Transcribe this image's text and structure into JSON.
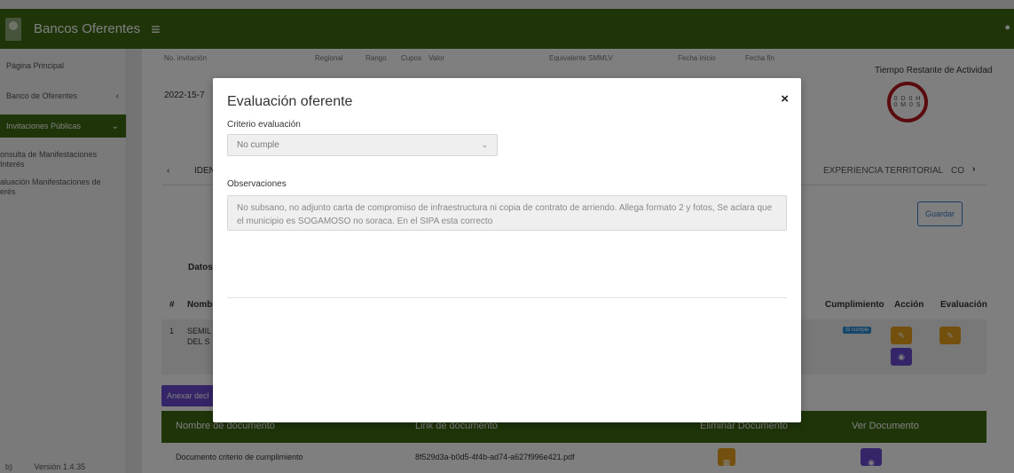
{
  "topbar": {
    "title": "Bancos Oferentes"
  },
  "sidebar": {
    "items": [
      {
        "label": "Página Principal"
      },
      {
        "label": "Banco de Oferentes"
      },
      {
        "label": "Invitaciones Públicas"
      }
    ],
    "subitems": [
      {
        "line1": "onsulta de Manifestaciones",
        "line2": "Interés"
      },
      {
        "line1": "aluación Manifestaciones de",
        "line2": "erés"
      }
    ],
    "footer_left": "b)",
    "version": "Versión 1.4.35"
  },
  "background": {
    "headers": [
      "No. invitación",
      "Regional",
      "Rango",
      "Cupos",
      "Valor",
      "Equivalente SMMLV",
      "Fecha inicio",
      "Fecha fin"
    ],
    "invitation_no": "2022-15-7",
    "timer_title": "Tiempo Restante de Actividad",
    "timer_line1": "0 D 0 H",
    "timer_line2": "0 M 0 S",
    "tab_left": "IDEN",
    "tab_experiencia": "EXPERIENCIA TERRITORIAL",
    "tab_right": "CO",
    "guardar": "Guardar",
    "datos": "Datos",
    "table_headers": {
      "num": "#",
      "nombre": "Nombr",
      "cumplimiento": "Cumplimiento",
      "accion": "Acción",
      "evaluacion": "Evaluación"
    },
    "row": {
      "num": "1",
      "name1": "SEMIL",
      "name2": "DEL S",
      "badge": "Si cumple"
    },
    "anexar": "Anexar decl",
    "doc_headers": {
      "nombre": "Nombre de documento",
      "link": "Link de documento",
      "eliminar": "Eliminar Documento",
      "ver": "Ver Documento"
    },
    "doc_row": {
      "nombre": "Documento criterio de cumplimiento",
      "link": "8f529d3a-b0d5-4f4b-ad74-a627f996e421.pdf"
    }
  },
  "modal": {
    "title": "Evaluación oferente",
    "criterio_label": "Criterio evaluación",
    "criterio_value": "No cumple",
    "observaciones_label": "Observaciones",
    "observaciones_text": "No subsano, no adjunto carta de compromiso de infraestructura ni copia de contrato de arriendo. Allega formato 2 y fotos, Se aclara que el municipio es SOGAMOSO no soraca. En el SIPA esta correcto"
  },
  "colors": {
    "brand_green": "#3f6b12",
    "accent_purple": "#6a4bd1",
    "accent_orange": "#e8a11c",
    "timer_red": "#b4161c"
  }
}
